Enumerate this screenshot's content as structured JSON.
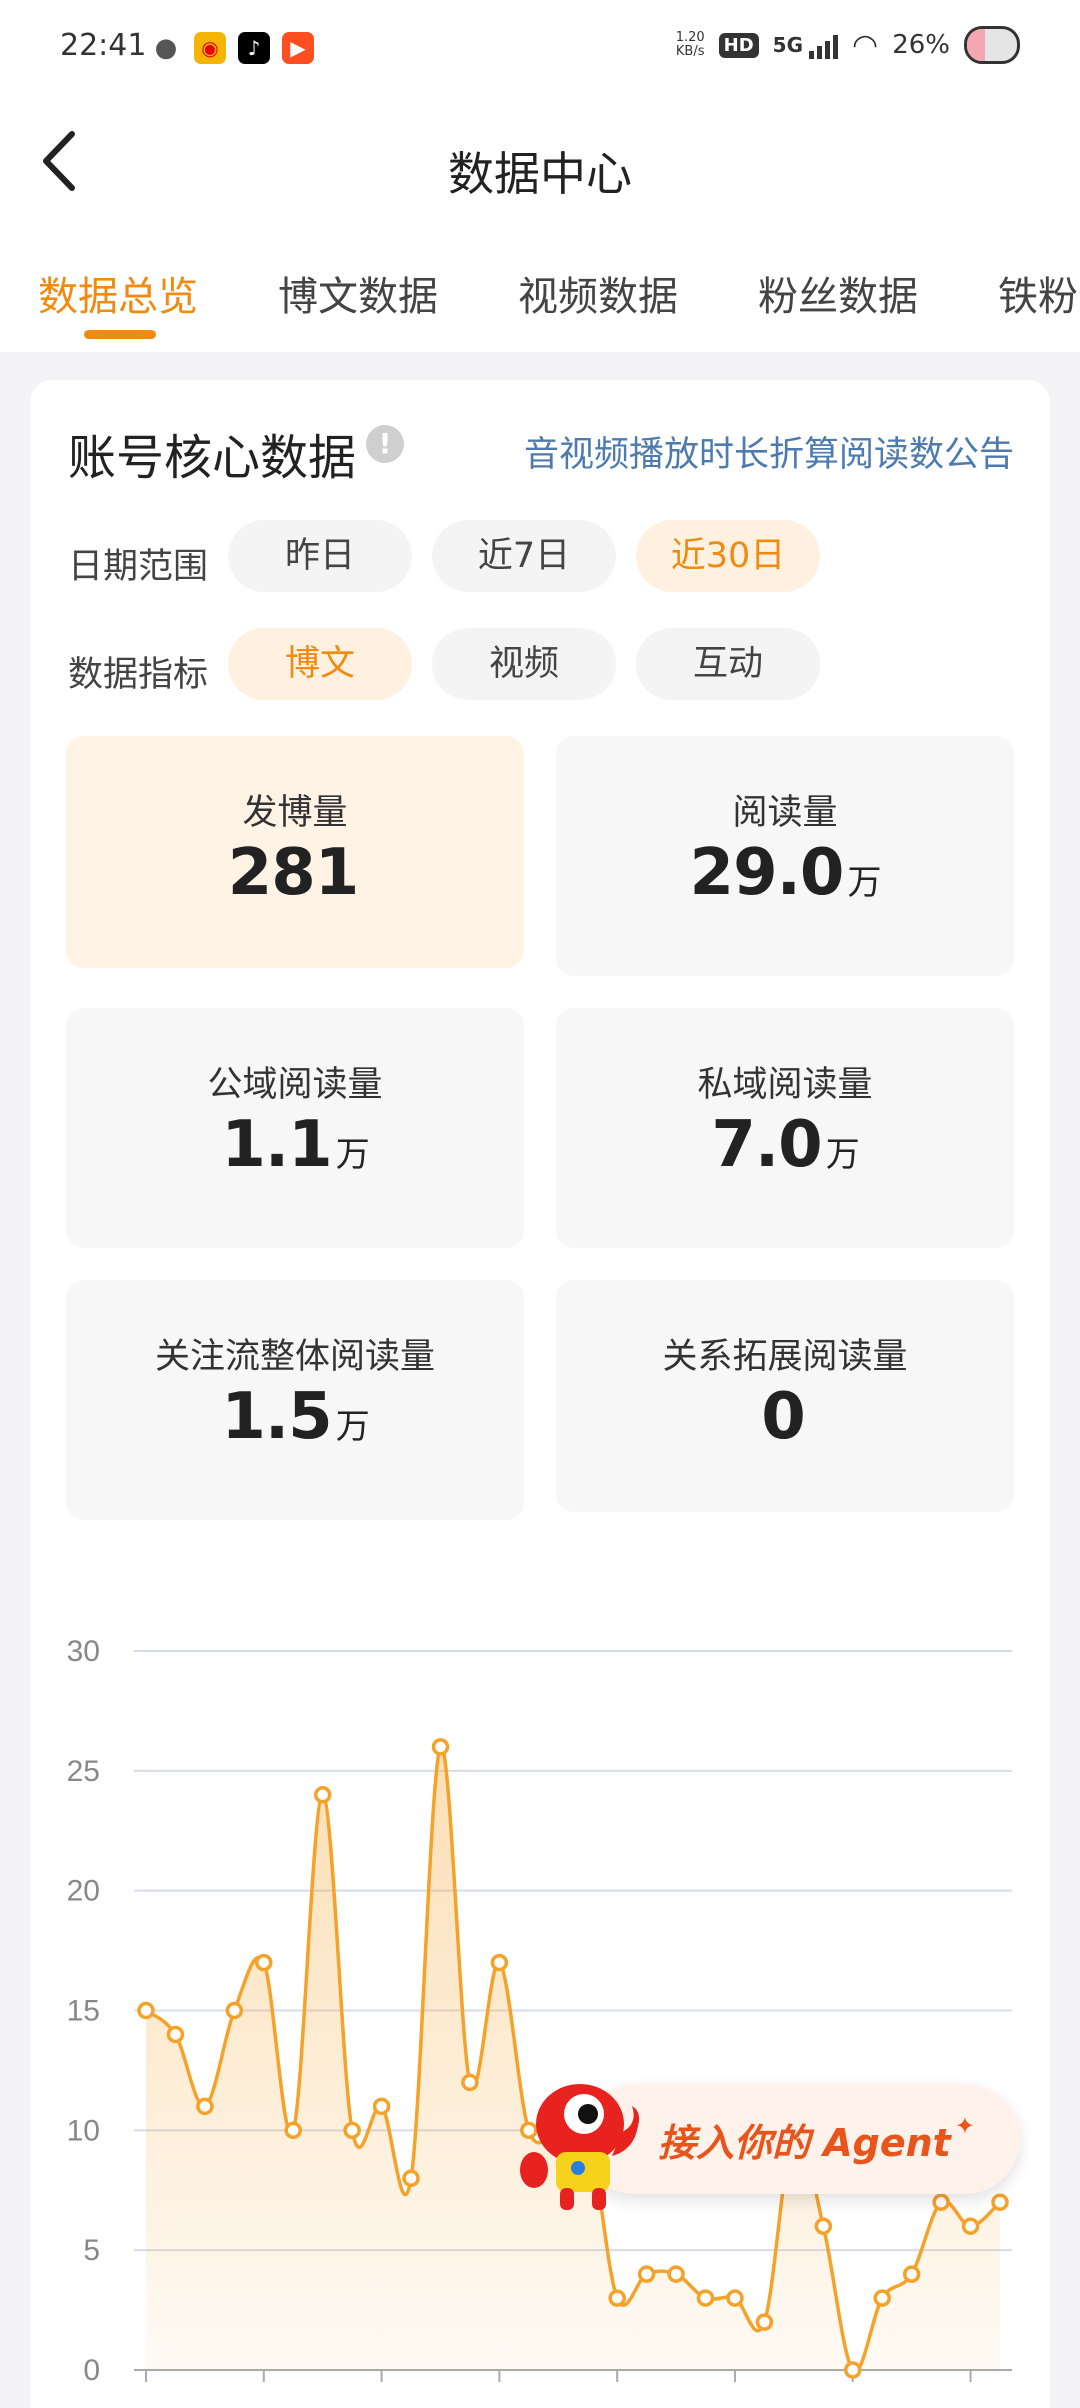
{
  "status": {
    "time": "22:41",
    "net_speed_value": "1.20",
    "net_speed_unit": "KB/s",
    "hd": "HD",
    "network": "5G",
    "battery": "26%"
  },
  "header": {
    "title": "数据中心"
  },
  "tabs": [
    {
      "label": "数据总览",
      "active": true
    },
    {
      "label": "博文数据",
      "active": false
    },
    {
      "label": "视频数据",
      "active": false
    },
    {
      "label": "粉丝数据",
      "active": false
    },
    {
      "label": "铁粉数据",
      "active": false
    }
  ],
  "card": {
    "title": "账号核心数据",
    "info": "!",
    "notice_link": "音视频播放时长折算阅读数公告",
    "date_range": {
      "label": "日期范围",
      "options": [
        "昨日",
        "近7日",
        "近30日"
      ],
      "selected": "近30日"
    },
    "metric": {
      "label": "数据指标",
      "options": [
        "博文",
        "视频",
        "互动"
      ],
      "selected": "博文"
    },
    "stats": [
      {
        "label": "发博量",
        "value": "281",
        "unit": ""
      },
      {
        "label": "阅读量",
        "value": "29.0",
        "unit": "万"
      },
      {
        "label": "公域阅读量",
        "value": "1.1",
        "unit": "万"
      },
      {
        "label": "私域阅读量",
        "value": "7.0",
        "unit": "万"
      },
      {
        "label": "关注流整体阅读量",
        "value": "1.5",
        "unit": "万"
      },
      {
        "label": "关系拓展阅读量",
        "value": "0",
        "unit": ""
      }
    ]
  },
  "chart_data": {
    "type": "area",
    "title": "",
    "xlabel": "",
    "ylabel": "",
    "ylim": [
      0,
      30
    ],
    "yticks": [
      0,
      5,
      10,
      15,
      20,
      25,
      30
    ],
    "grid": true,
    "color": "#f5a22a",
    "series": [
      {
        "values": [
          15,
          14,
          11,
          15,
          17,
          10,
          24,
          10,
          11,
          8,
          26,
          12,
          17,
          10,
          10,
          10,
          3,
          4,
          4,
          3,
          3,
          2,
          10,
          6,
          0,
          3,
          4,
          7,
          6,
          7
        ]
      }
    ]
  },
  "agent": {
    "label": "接入你的 Agent",
    "sparkle": "✦"
  }
}
